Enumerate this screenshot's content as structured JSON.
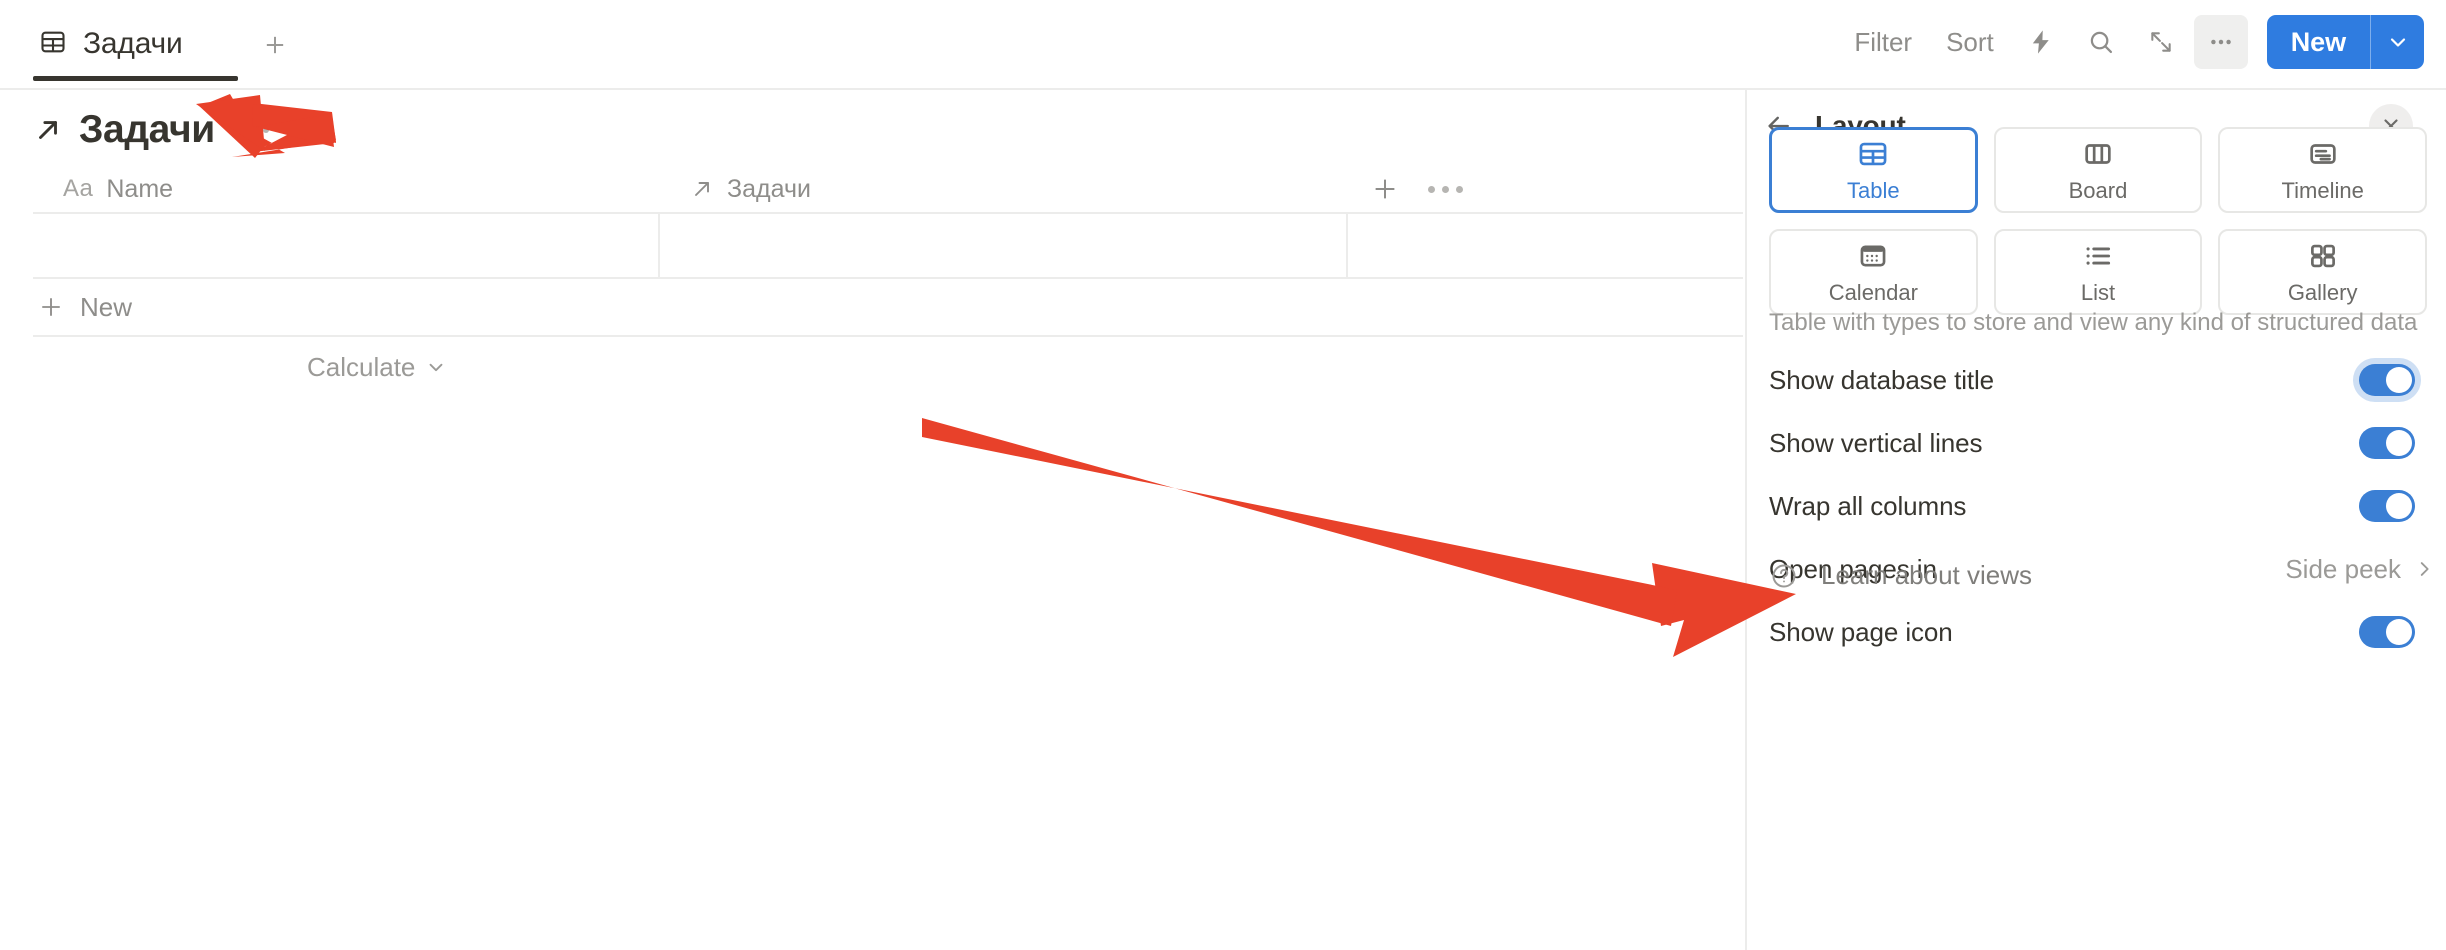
{
  "topbar": {
    "tab": {
      "label": "Задачи",
      "icon": "table-icon",
      "active": true
    },
    "add_tab_icon": "plus-icon",
    "toolbar": {
      "filter_label": "Filter",
      "sort_label": "Sort",
      "automation_icon": "lightning-bolt-icon",
      "search_icon": "search-icon",
      "expand_icon": "expand-arrows-icon",
      "more_icon": "ellipsis-icon",
      "new_label": "New",
      "new_caret_icon": "chevron-down-icon"
    }
  },
  "database": {
    "title": "Задачи",
    "title_icon": "arrow-up-right-icon",
    "title_menu_icon": "ellipsis-icon",
    "columns": [
      {
        "label": "Name",
        "type_icon": "aa-text-icon",
        "type_badge": "Aa"
      },
      {
        "label": "Задачи",
        "type_icon": "arrow-up-right-icon"
      }
    ],
    "add_column_icon": "plus-icon",
    "column_menu_icon": "ellipsis-icon",
    "rows": [
      {
        "name": "",
        "relation": ""
      }
    ],
    "new_row_label": "New",
    "new_row_icon": "plus-icon",
    "calculate_label": "Calculate",
    "calculate_caret_icon": "chevron-down-icon"
  },
  "panel": {
    "back_icon": "arrow-left-icon",
    "title": "Layout",
    "close_icon": "close-icon",
    "layouts": [
      {
        "label": "Table",
        "icon": "table-grid-icon",
        "selected": true
      },
      {
        "label": "Board",
        "icon": "board-columns-icon",
        "selected": false
      },
      {
        "label": "Timeline",
        "icon": "timeline-icon",
        "selected": false
      },
      {
        "label": "Calendar",
        "icon": "calendar-icon",
        "selected": false
      },
      {
        "label": "List",
        "icon": "list-icon",
        "selected": false
      },
      {
        "label": "Gallery",
        "icon": "gallery-grid-icon",
        "selected": false
      }
    ],
    "description": "Table with types to store and view any kind of structured data",
    "settings": [
      {
        "label": "Show database title",
        "control": "toggle",
        "value": "on",
        "focused": true
      },
      {
        "label": "Show vertical lines",
        "control": "toggle",
        "value": "on",
        "focused": false
      },
      {
        "label": "Wrap all columns",
        "control": "toggle",
        "value": "on",
        "focused": false
      },
      {
        "label": "Open pages in",
        "control": "select",
        "value": "Side peek",
        "caret_icon": "chevron-right-icon"
      },
      {
        "label": "Show page icon",
        "control": "toggle",
        "value": "on",
        "focused": false
      }
    ],
    "footer": {
      "label": "Learn about views",
      "icon": "question-circle-icon"
    }
  },
  "annotations": {
    "color": "#E8412A",
    "arrows": [
      {
        "name": "arrow-pointing-database-title-menu",
        "target": "database title ellipsis menu"
      },
      {
        "name": "arrow-pointing-show-database-title",
        "target": "Show database title setting"
      }
    ]
  },
  "colors": {
    "accent_blue": "#2f7ce0",
    "selected_blue": "#3b7fd4",
    "text": "#37352f",
    "muted_text": "#9b9a97",
    "border": "#ececeb",
    "annotation_red": "#E8412A"
  }
}
